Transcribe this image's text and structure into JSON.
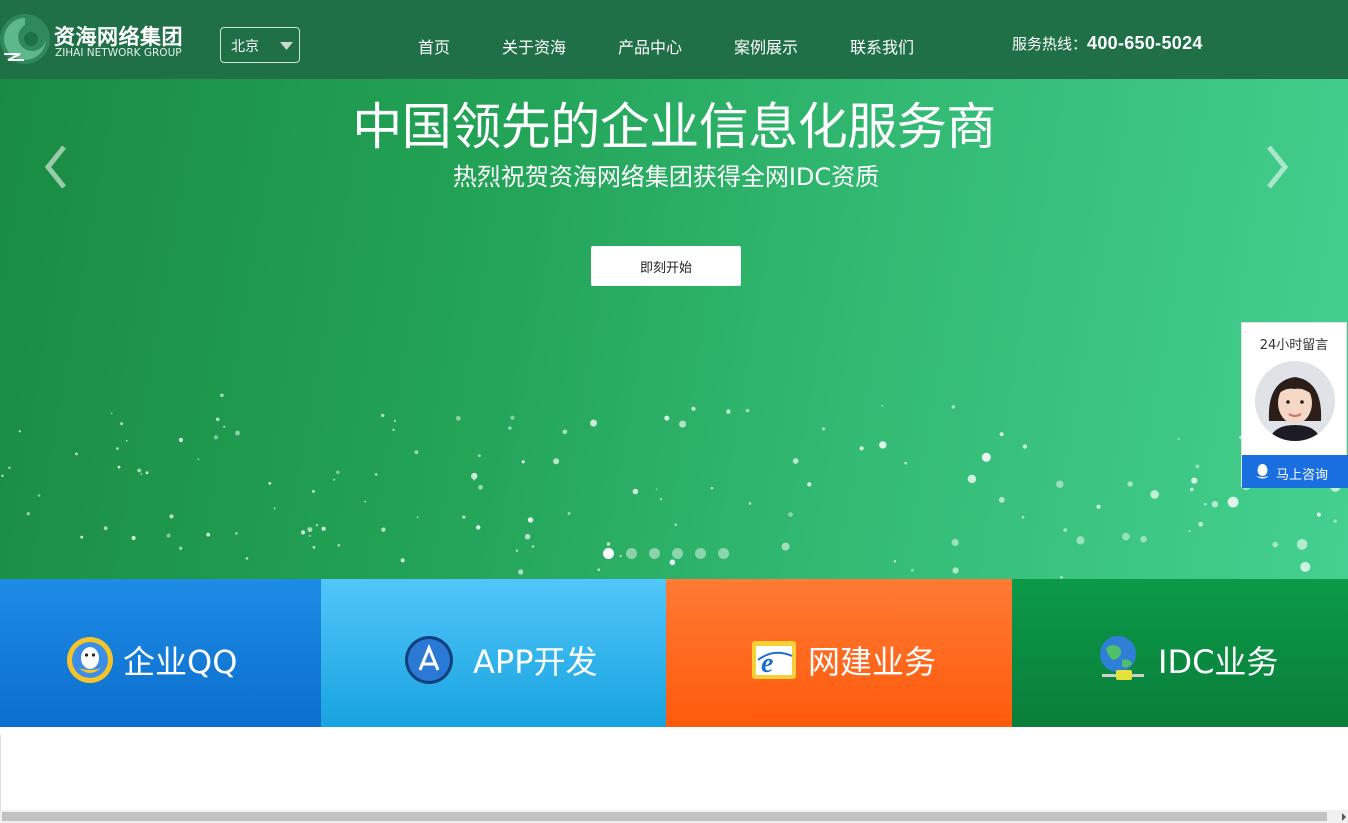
{
  "brand": {
    "name_cn": "资海网络集团",
    "name_en": "ZIHAI NETWORK GROUP"
  },
  "city_select": {
    "selected": "北京"
  },
  "nav": {
    "items": [
      {
        "label": "首页"
      },
      {
        "label": "关于资海"
      },
      {
        "label": "产品中心"
      },
      {
        "label": "案例展示"
      },
      {
        "label": "联系我们"
      }
    ]
  },
  "hotline": {
    "label": "服务热线：",
    "number": "400-650-5024"
  },
  "banner": {
    "title": "中国领先的企业信息化服务商",
    "subtitle": "热烈祝贺资海网络集团获得全网IDC资质",
    "cta_label": "即刻开始",
    "slide_count": 6,
    "active_slide": 1
  },
  "services": [
    {
      "label": "企业QQ",
      "icon": "qq-penguin-icon"
    },
    {
      "label": "APP开发",
      "icon": "app-store-icon"
    },
    {
      "label": "网建业务",
      "icon": "internet-explorer-icon"
    },
    {
      "label": "IDC业务",
      "icon": "globe-network-icon"
    }
  ],
  "consult_widget": {
    "title": "24小时留言",
    "button_label": "马上咨询"
  },
  "colors": {
    "header_bg": "#1f6f47",
    "banner_green": "#22a356",
    "tile_qq": "#0b6ecc",
    "tile_app": "#17a3e0",
    "tile_web": "#ff5a0b",
    "tile_idc": "#0a7e3a",
    "consult_blue": "#1a6fe0"
  }
}
